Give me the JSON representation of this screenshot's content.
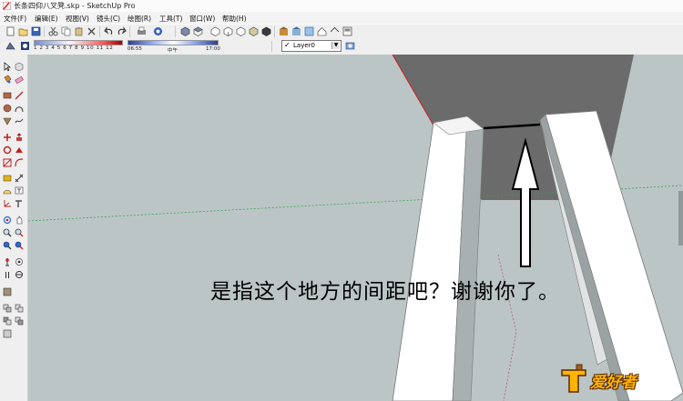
{
  "window": {
    "title": "长条四仰八叉凳.skp - SketchUp Pro"
  },
  "menu": [
    {
      "label": "文件(F)"
    },
    {
      "label": "编辑(E)"
    },
    {
      "label": "视图(V)"
    },
    {
      "label": "镜头(C)"
    },
    {
      "label": "绘图(R)"
    },
    {
      "label": "工具(T)"
    },
    {
      "label": "窗口(W)"
    },
    {
      "label": "帮助(H)"
    }
  ],
  "shadow": {
    "hours": "1 2 3 4 5 6 7 8 9 10 11 12",
    "time_start": "06:55",
    "time_noon": "中午",
    "time_end": "17:00"
  },
  "layer": {
    "current": "Layer0"
  },
  "annotation": {
    "text": "是指这个地方的间距吧？谢谢你了。"
  },
  "icons": {
    "toolbar": [
      "new-icon",
      "open-icon",
      "save-icon",
      "cut-icon",
      "copy-icon",
      "paste-icon",
      "erase-icon",
      "undo-icon",
      "redo-icon",
      "print-icon",
      "model-info-icon",
      "iso-view-icon",
      "top-view-icon",
      "front-view-icon",
      "right-view-icon",
      "back-view-icon",
      "left-view-icon",
      "xray-icon",
      "wireframe-icon",
      "hidden-line-icon",
      "shaded-icon",
      "shaded-texture-icon",
      "monochrome-icon",
      "warehouse-icon",
      "share-model-icon",
      "components-icon",
      "home-icon",
      "extension-icon"
    ],
    "tools": [
      "select-icon",
      "component-icon",
      "paint-icon",
      "eraser-icon",
      "rectangle-icon",
      "line-icon",
      "circle-icon",
      "arc-icon",
      "polygon-icon",
      "freehand-icon",
      "move-icon",
      "push-pull-icon",
      "rotate-icon",
      "follow-me-icon",
      "scale-icon",
      "offset-icon",
      "tape-icon",
      "dimension-icon",
      "protractor-icon",
      "text-icon",
      "axes-icon",
      "3d-text-icon",
      "orbit-icon",
      "pan-icon",
      "zoom-icon",
      "zoom-window-icon",
      "zoom-extents-icon",
      "previous-icon",
      "walk-icon",
      "look-around-icon",
      "position-camera-icon",
      "section-icon"
    ]
  },
  "colors": {
    "viewport_bg": "#bcc5c6",
    "plank": "#ffffff",
    "seat_underside": "#6b6b6b",
    "accent_red": "#d02020"
  }
}
